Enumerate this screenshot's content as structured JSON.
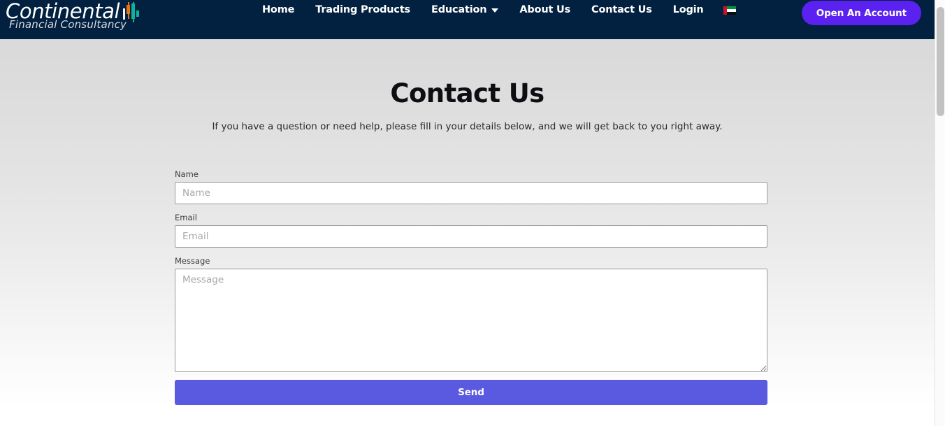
{
  "header": {
    "logo": {
      "name_main": "Continental",
      "name_sub": "Financial Consultancy",
      "icon": "candlestick-chart-icon"
    },
    "nav_items": [
      {
        "label": "Home",
        "has_dropdown": false
      },
      {
        "label": "Trading Products",
        "has_dropdown": false
      },
      {
        "label": "Education",
        "has_dropdown": true
      },
      {
        "label": "About Us",
        "has_dropdown": false
      },
      {
        "label": "Contact Us",
        "has_dropdown": false
      },
      {
        "label": "Login",
        "has_dropdown": false
      }
    ],
    "language_flag": {
      "icon": "uae-flag-icon",
      "country": "United Arab Emirates"
    },
    "cta_label": "Open An Account",
    "background_color": "#02203f",
    "cta_color": "#5b21f0"
  },
  "main": {
    "title": "Contact Us",
    "subtitle": "If you have a question or need help, please fill in your details below, and we will get back to you right away.",
    "form": {
      "fields": [
        {
          "label": "Name",
          "placeholder": "Name",
          "value": "",
          "type": "text"
        },
        {
          "label": "Email",
          "placeholder": "Email",
          "value": "",
          "type": "email"
        },
        {
          "label": "Message",
          "placeholder": "Message",
          "value": "",
          "type": "textarea"
        }
      ],
      "submit_label": "Send",
      "submit_color": "#5a5ae0"
    }
  },
  "scrollbar": {
    "orientation": "vertical",
    "thumb_position_percent": 2
  }
}
